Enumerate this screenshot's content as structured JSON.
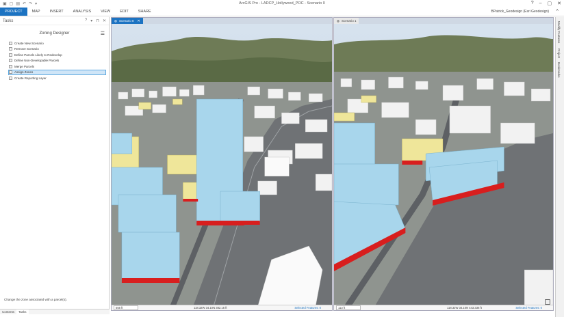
{
  "app": {
    "title": "ArcGIS Pro - LADCP_Hollywood_POC - Scenario 0",
    "user": "BPatrick_Geodesign (Esri Geodesign)",
    "qat": [
      "▣",
      "▢",
      "▤",
      "↶",
      "↷",
      "▾"
    ],
    "window_controls": [
      "?",
      "–",
      "▢",
      "✕"
    ]
  },
  "ribbon": {
    "tabs": [
      "PROJECT",
      "MAP",
      "INSERT",
      "ANALYSIS",
      "VIEW",
      "EDIT",
      "SHARE"
    ],
    "active": 0
  },
  "tasks_pane": {
    "title": "Tasks",
    "controls": [
      "?",
      "▾",
      "⊓",
      "✕"
    ],
    "designer": "Zoning Designer",
    "items": [
      "Create New Scenario",
      "Remove Scenario",
      "Define Parcels Likely to Redevelop",
      "Define Non-Developable Parcels",
      "Merge Parcels",
      "Assign Zones",
      "Create Reporting Layer"
    ],
    "selected_index": 5,
    "description": "Change the zone associated with a parcel(s).",
    "bottom_tabs": [
      "Contents",
      "Tasks"
    ]
  },
  "views": [
    {
      "tab": "Scenario 0",
      "close": "✕",
      "scale": "555 ft",
      "coords": "118.32W 34.10N  382.15 ft",
      "selected": "Selected Features: 0"
    },
    {
      "tab": "Scenario 1",
      "close": "",
      "scale": "113 ft",
      "coords": "118.32W 34.10N  443.336 ft",
      "selected": "Selected Features: 0"
    }
  ],
  "side_panel": [
    "Modify Features",
    "Project",
    "Bookmarks"
  ],
  "colors": {
    "accent": "#1c73c2",
    "building_blue": "#a8d6ec",
    "building_yellow": "#efe69a",
    "parcel_red": "#d81e1e",
    "building_white": "#f4f4f4"
  }
}
